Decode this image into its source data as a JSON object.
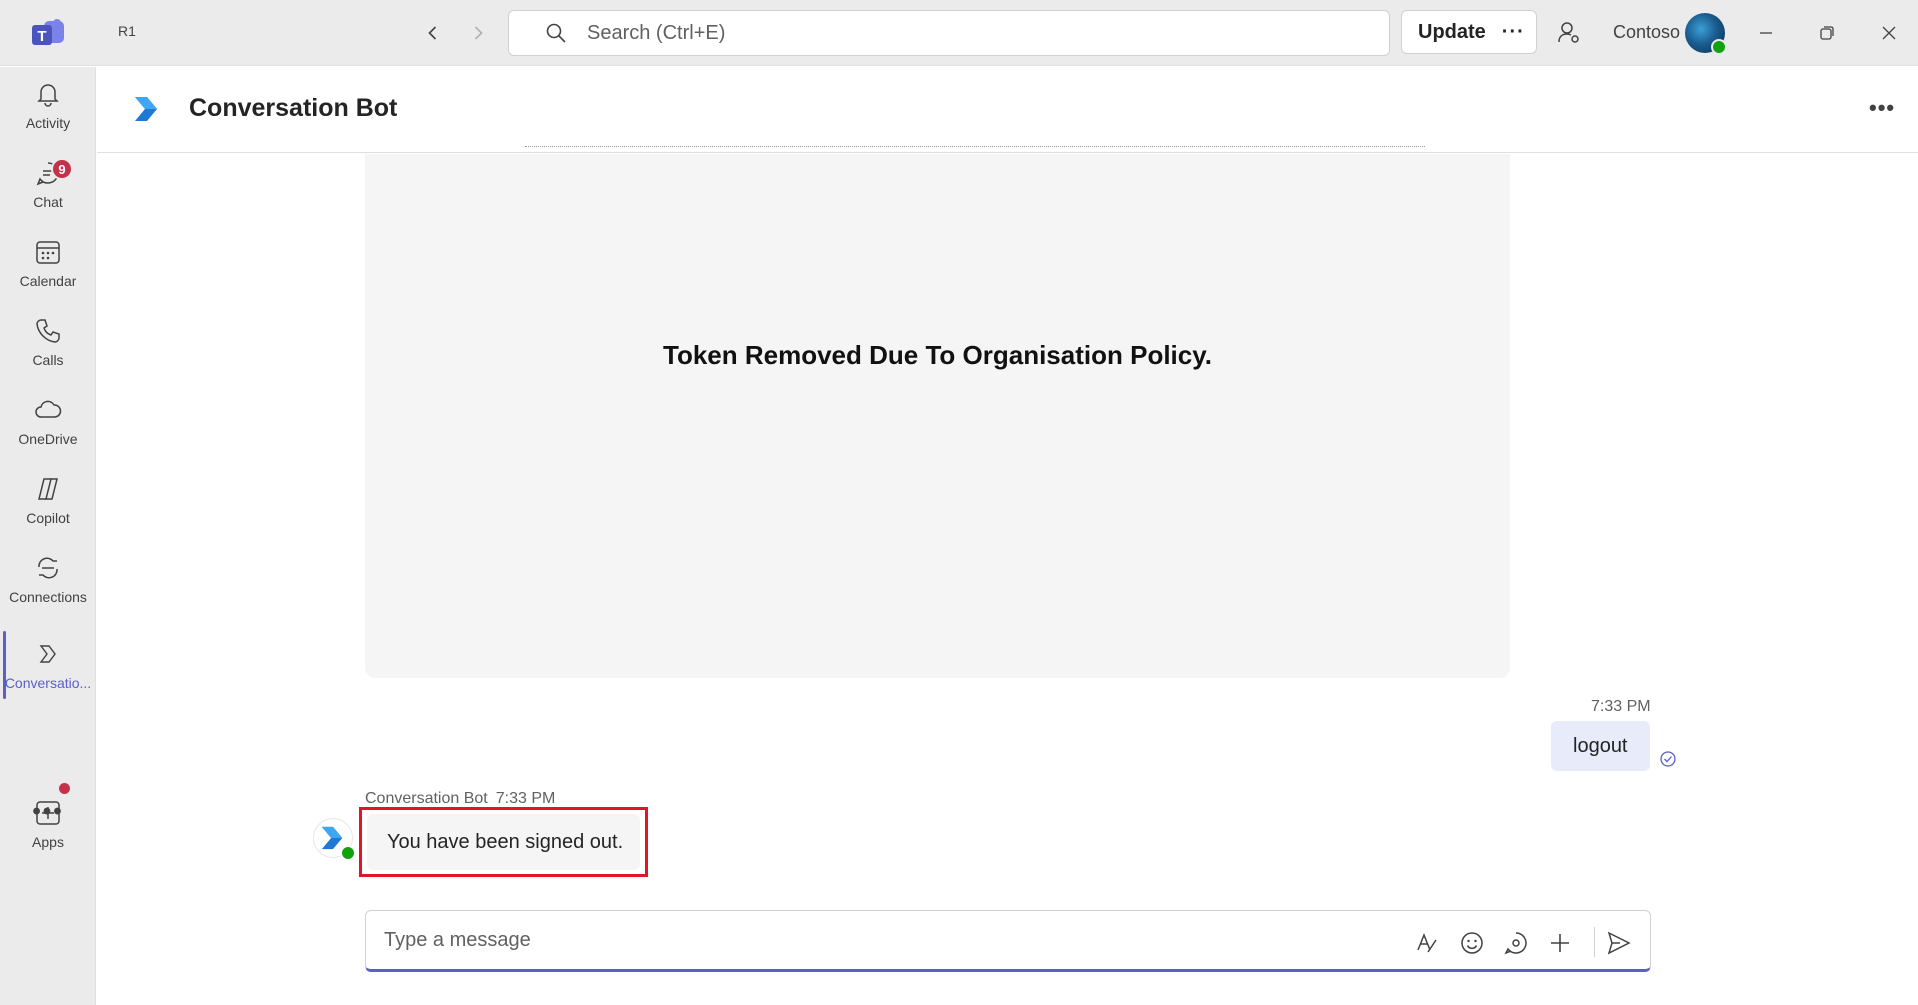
{
  "app": {
    "window_badge": "R1",
    "search_placeholder": "Search (Ctrl+E)",
    "update_label": "Update",
    "update_more": "···",
    "org_name": "Contoso"
  },
  "rail": {
    "items": [
      {
        "label": "Activity",
        "icon": "bell-icon"
      },
      {
        "label": "Chat",
        "icon": "chat-icon",
        "badge": "9"
      },
      {
        "label": "Calendar",
        "icon": "calendar-icon"
      },
      {
        "label": "Calls",
        "icon": "phone-icon"
      },
      {
        "label": "OneDrive",
        "icon": "cloud-icon"
      },
      {
        "label": "Copilot",
        "icon": "copilot-icon"
      },
      {
        "label": "Connections",
        "icon": "connections-icon"
      },
      {
        "label": "Conversatio...",
        "icon": "bot-app-icon",
        "active": true
      },
      {
        "label": "Apps",
        "icon": "add-apps-icon"
      }
    ],
    "more_label": "•••"
  },
  "chat": {
    "title": "Conversation Bot",
    "header_more": "•••",
    "card_message": "Token Removed Due To Organisation Policy.",
    "outgoing": {
      "time": "7:33 PM",
      "text": "logout"
    },
    "incoming": {
      "sender": "Conversation Bot",
      "time": "7:33 PM",
      "text": "You have been signed out."
    },
    "compose_placeholder": "Type a message"
  },
  "colors": {
    "accent": "#5b5fc7",
    "highlight_border": "#e0142a",
    "badge": "#c4314b",
    "presence": "#13a10e"
  }
}
